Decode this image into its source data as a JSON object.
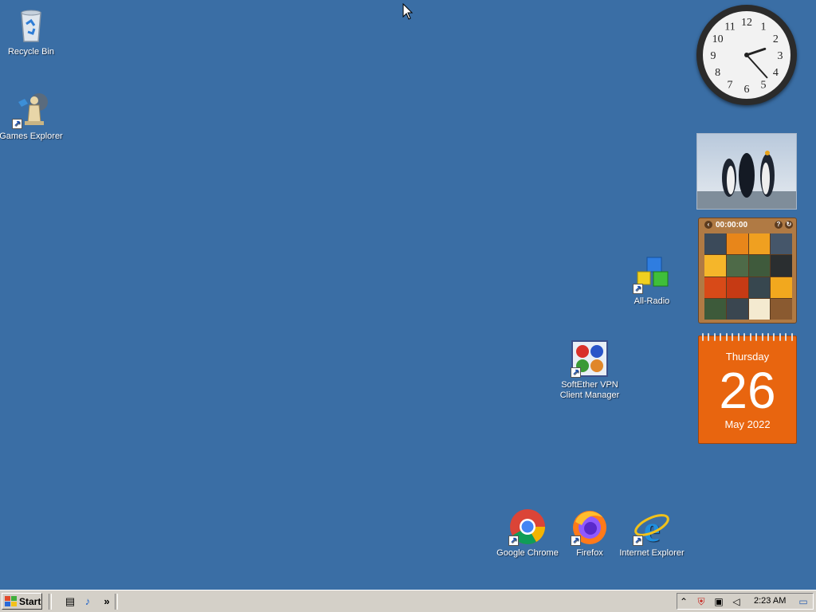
{
  "desktop": {
    "icons": [
      {
        "label": "Recycle Bin"
      },
      {
        "label": "Games Explorer"
      },
      {
        "label": "All-Radio"
      },
      {
        "label": "SoftEther VPN Client Manager"
      },
      {
        "label": "Google Chrome"
      },
      {
        "label": "Firefox"
      },
      {
        "label": "Internet Explorer"
      }
    ]
  },
  "gadgets": {
    "clock": {
      "numerals": [
        "12",
        "1",
        "2",
        "3",
        "4",
        "5",
        "6",
        "7",
        "8",
        "9",
        "10",
        "11"
      ],
      "hour": 2,
      "minute": 23
    },
    "puzzle": {
      "timer": "00:00:00"
    },
    "calendar": {
      "weekday": "Thursday",
      "day": "26",
      "month_year": "May 2022"
    }
  },
  "taskbar": {
    "start_label": "Start",
    "clock": "2:23 AM",
    "quick_launch": [
      "show-desktop-icon",
      "media-player-icon"
    ],
    "tray_icons": [
      "expand-tray-icon",
      "security-alert-icon",
      "network-icon",
      "volume-icon",
      "desktop-icon"
    ]
  },
  "colors": {
    "desktop": "#3a6ea5",
    "taskbar": "#d4d0c8",
    "calendar": "#e8650f"
  }
}
